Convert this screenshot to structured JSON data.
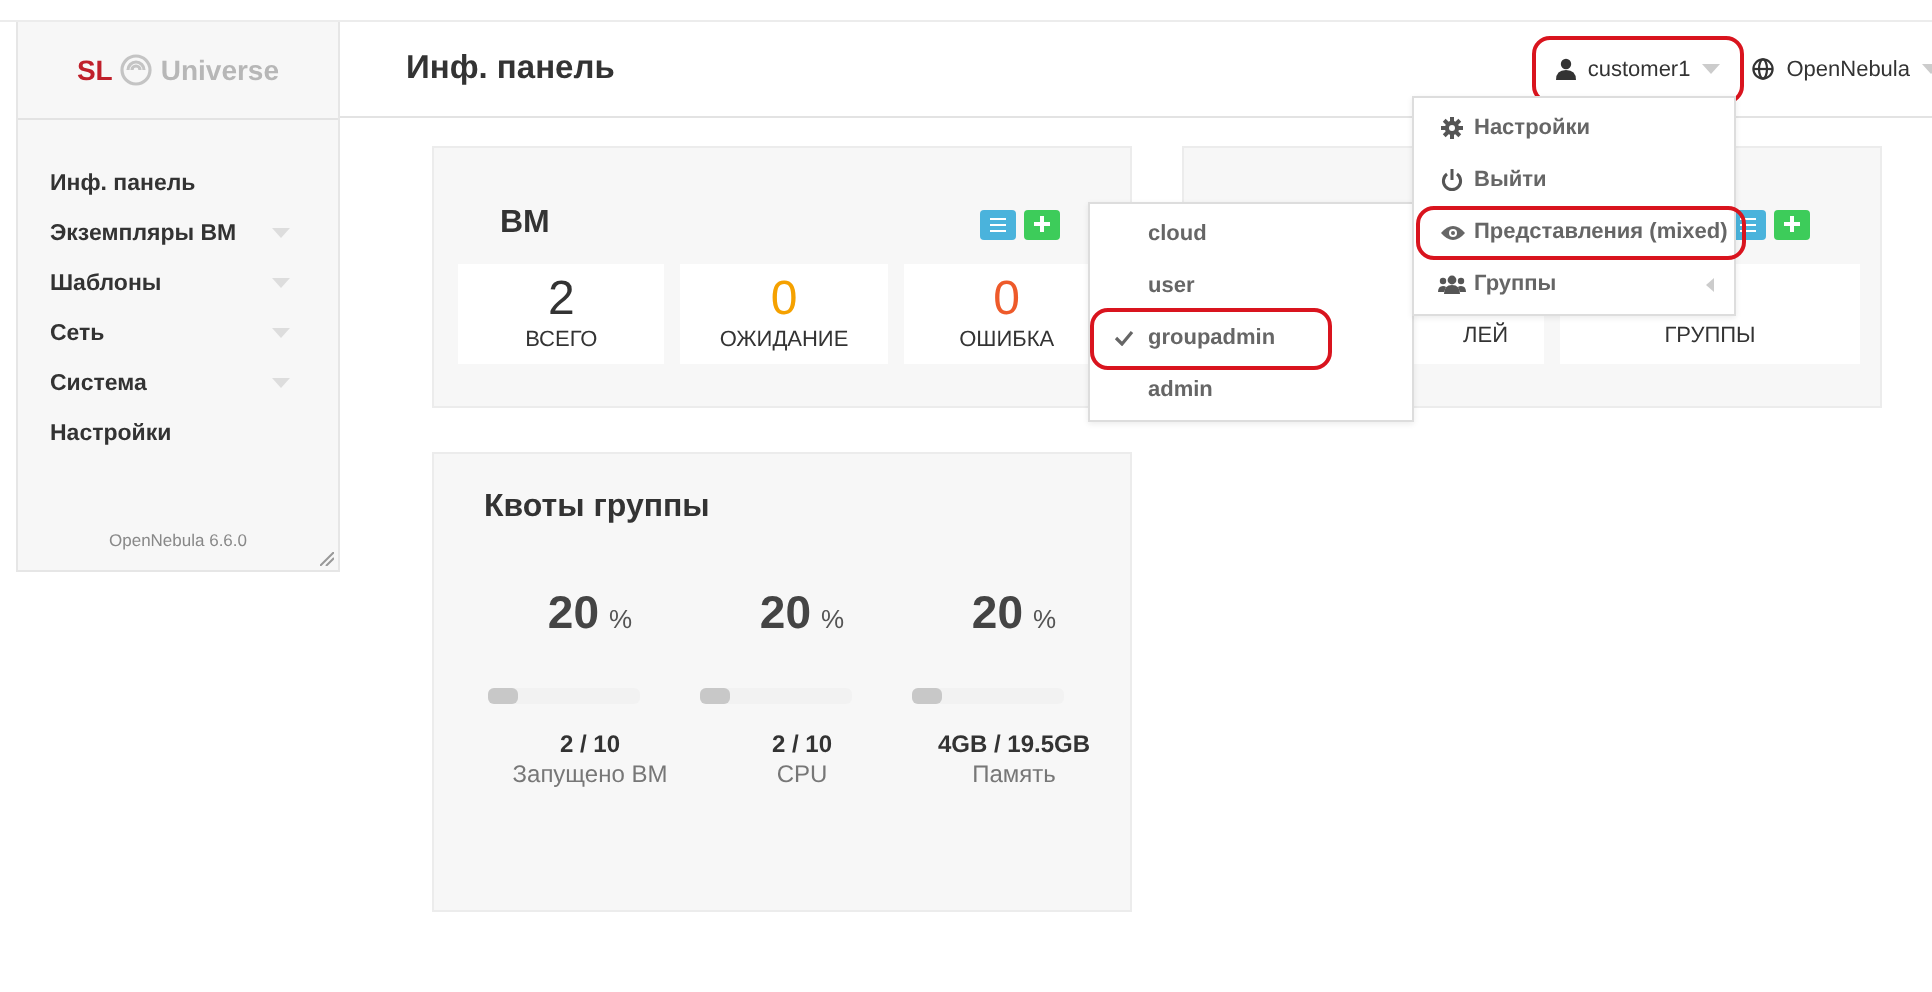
{
  "logo": {
    "brand": "SL",
    "name": "Universe"
  },
  "header": {
    "title": "Инф. панель",
    "user": {
      "label": "customer1",
      "highlighted": true
    },
    "zone": {
      "label": "OpenNebula"
    }
  },
  "sidebar": {
    "items": [
      {
        "label": "Инф. панель",
        "expandable": false
      },
      {
        "label": "Экземпляры ВМ",
        "expandable": true
      },
      {
        "label": "Шаблоны",
        "expandable": true
      },
      {
        "label": "Сеть",
        "expandable": true
      },
      {
        "label": "Система",
        "expandable": true
      },
      {
        "label": "Настройки",
        "expandable": false
      }
    ],
    "version": "OpenNebula 6.6.0"
  },
  "vm_card": {
    "title": "ВМ",
    "stats": [
      {
        "value": "2",
        "label": "ВСЕГО",
        "kind": "total"
      },
      {
        "value": "0",
        "label": "ОЖИДАНИЕ",
        "kind": "pending"
      },
      {
        "value": "0",
        "label": "ОШИБКА",
        "kind": "error"
      }
    ]
  },
  "system_card": {
    "stats": [
      {
        "label": "ЛЕЙ"
      },
      {
        "label": "ГРУППЫ"
      }
    ]
  },
  "quota_card": {
    "title": "Квоты группы",
    "items": [
      {
        "percent": "20",
        "unit": "%",
        "level": 0.2,
        "usage": "2 / 10",
        "label": "Запущено ВМ"
      },
      {
        "percent": "20",
        "unit": "%",
        "level": 0.2,
        "usage": "2 / 10",
        "label": "CPU"
      },
      {
        "percent": "20",
        "unit": "%",
        "level": 0.2,
        "usage": "4GB / 19.5GB",
        "label": "Память"
      }
    ]
  },
  "user_menu": {
    "items": [
      {
        "label": "Настройки",
        "kind": "settings",
        "highlighted": false,
        "submenu": false
      },
      {
        "label": "Выйти",
        "kind": "logout",
        "highlighted": false,
        "submenu": false
      },
      {
        "label": "Представления (mixed)",
        "kind": "views",
        "highlighted": true,
        "submenu": false
      },
      {
        "label": "Группы",
        "kind": "groups",
        "highlighted": false,
        "submenu": true
      }
    ]
  },
  "views_menu": {
    "items": [
      {
        "label": "cloud",
        "selected": false,
        "highlighted": false
      },
      {
        "label": "user",
        "selected": false,
        "highlighted": false
      },
      {
        "label": "groupadmin",
        "selected": true,
        "highlighted": true
      },
      {
        "label": "admin",
        "selected": false,
        "highlighted": false
      }
    ]
  }
}
